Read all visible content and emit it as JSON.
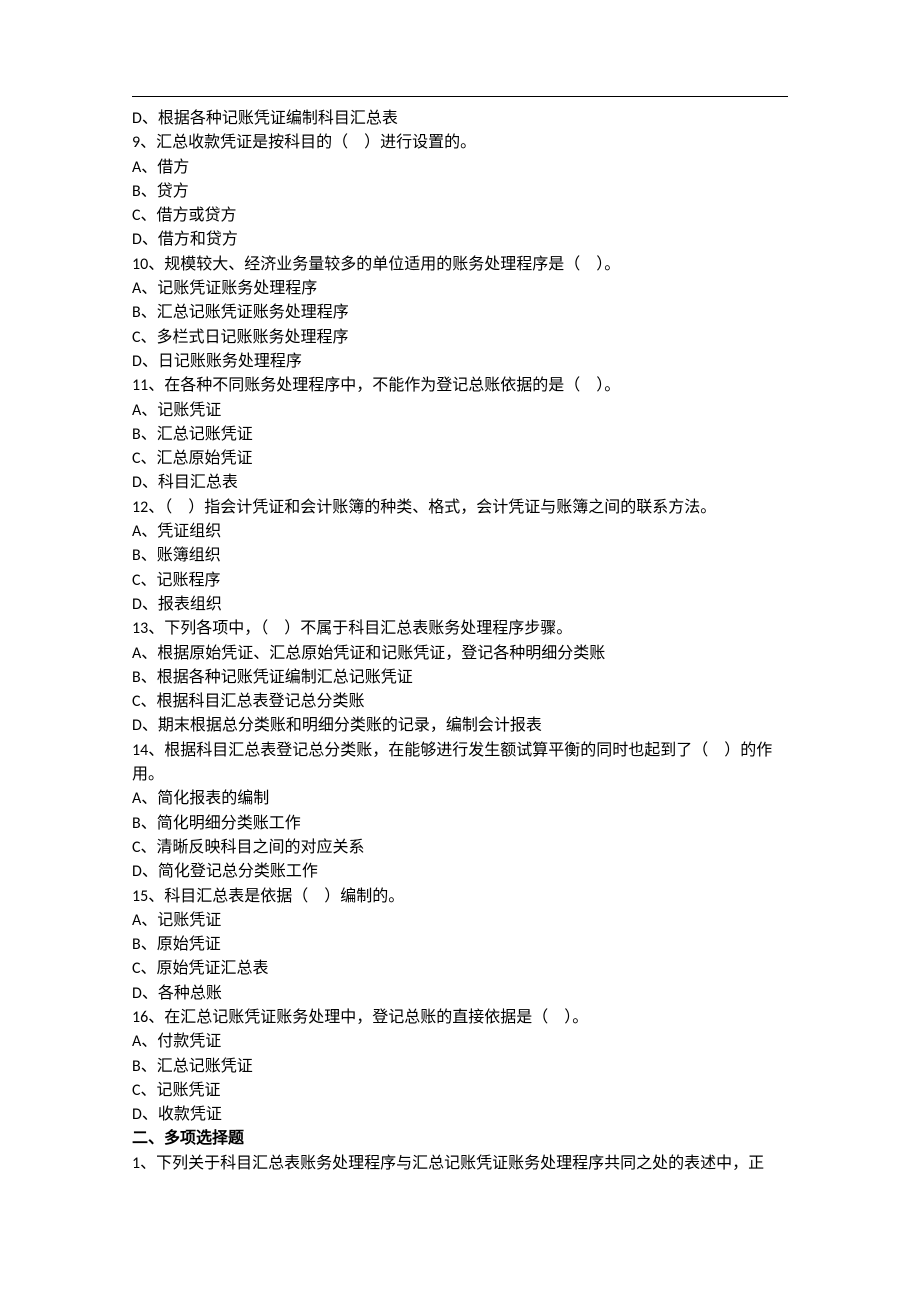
{
  "lines": [
    {
      "key": "l_d_prev",
      "text": "D、根据各种记账凭证编制科目汇总表"
    },
    {
      "key": "q9",
      "text": "9、汇总收款凭证是按科目的（    ）进行设置的。"
    },
    {
      "key": "q9a",
      "text": "A、借方"
    },
    {
      "key": "q9b",
      "text": "B、贷方"
    },
    {
      "key": "q9c",
      "text": "C、借方或贷方"
    },
    {
      "key": "q9d",
      "text": "D、借方和贷方"
    },
    {
      "key": "q10",
      "text": "10、规模较大、经济业务量较多的单位适用的账务处理程序是（    ）。"
    },
    {
      "key": "q10a",
      "text": "A、记账凭证账务处理程序"
    },
    {
      "key": "q10b",
      "text": "B、汇总记账凭证账务处理程序"
    },
    {
      "key": "q10c",
      "text": "C、多栏式日记账账务处理程序"
    },
    {
      "key": "q10d",
      "text": "D、日记账账务处理程序"
    },
    {
      "key": "q11",
      "text": "11、在各种不同账务处理程序中，不能作为登记总账依据的是（    ）。"
    },
    {
      "key": "q11a",
      "text": "A、记账凭证"
    },
    {
      "key": "q11b",
      "text": "B、汇总记账凭证"
    },
    {
      "key": "q11c",
      "text": "C、汇总原始凭证"
    },
    {
      "key": "q11d",
      "text": "D、科目汇总表"
    },
    {
      "key": "q12",
      "text": "12、（    ）指会计凭证和会计账簿的种类、格式，会计凭证与账簿之间的联系方法。"
    },
    {
      "key": "q12a",
      "text": "A、凭证组织"
    },
    {
      "key": "q12b",
      "text": "B、账簿组织"
    },
    {
      "key": "q12c",
      "text": "C、记账程序"
    },
    {
      "key": "q12d",
      "text": "D、报表组织"
    },
    {
      "key": "q13",
      "text": "13、下列各项中，（    ）不属于科目汇总表账务处理程序步骤。"
    },
    {
      "key": "q13a",
      "text": "A、根据原始凭证、汇总原始凭证和记账凭证，登记各种明细分类账"
    },
    {
      "key": "q13b",
      "text": "B、根据各种记账凭证编制汇总记账凭证"
    },
    {
      "key": "q13c",
      "text": "C、根据科目汇总表登记总分类账"
    },
    {
      "key": "q13d",
      "text": "D、期末根据总分类账和明细分类账的记录，编制会计报表"
    },
    {
      "key": "q14_1",
      "text": "14、根据科目汇总表登记总分类账，在能够进行发生额试算平衡的同时也起到了（    ）的作"
    },
    {
      "key": "q14_2",
      "text": "用。"
    },
    {
      "key": "q14a",
      "text": "A、简化报表的编制"
    },
    {
      "key": "q14b",
      "text": "B、简化明细分类账工作"
    },
    {
      "key": "q14c",
      "text": "C、清晰反映科目之间的对应关系"
    },
    {
      "key": "q14d",
      "text": "D、简化登记总分类账工作"
    },
    {
      "key": "q15",
      "text": "15、科目汇总表是依据（    ）编制的。"
    },
    {
      "key": "q15a",
      "text": "A、记账凭证"
    },
    {
      "key": "q15b",
      "text": "B、原始凭证"
    },
    {
      "key": "q15c",
      "text": "C、原始凭证汇总表"
    },
    {
      "key": "q15d",
      "text": "D、各种总账"
    },
    {
      "key": "q16",
      "text": "16、在汇总记账凭证账务处理中，登记总账的直接依据是（    ）。"
    },
    {
      "key": "q16a",
      "text": "A、付款凭证"
    },
    {
      "key": "q16b",
      "text": "B、汇总记账凭证"
    },
    {
      "key": "q16c",
      "text": "C、记账凭证"
    },
    {
      "key": "q16d",
      "text": "D、收款凭证"
    },
    {
      "key": "section2",
      "text": "二、多项选择题",
      "bold": true
    },
    {
      "key": "s2q1",
      "text": "1、下列关于科目汇总表账务处理程序与汇总记账凭证账务处理程序共同之处的表述中，正"
    }
  ]
}
